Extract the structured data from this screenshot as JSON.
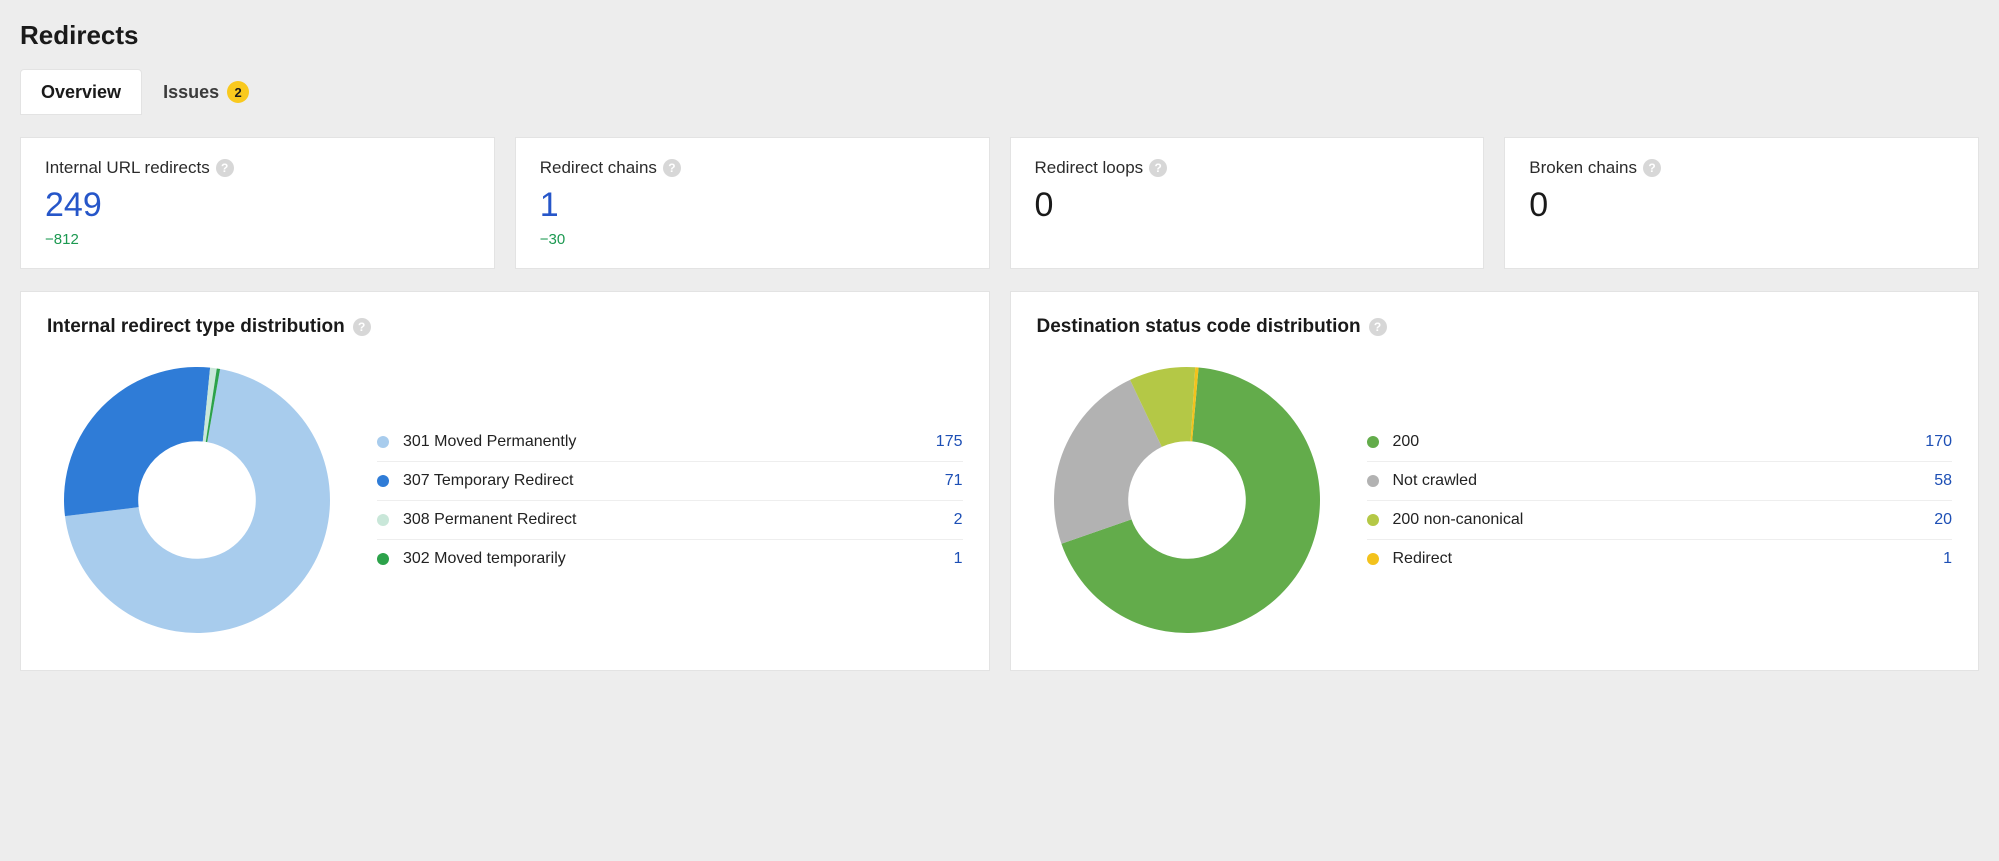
{
  "page_title": "Redirects",
  "tabs": {
    "overview": "Overview",
    "issues": "Issues",
    "issues_count": "2"
  },
  "stats": {
    "internal_redirects": {
      "label": "Internal URL redirects",
      "value": "249",
      "delta": "−812"
    },
    "redirect_chains": {
      "label": "Redirect chains",
      "value": "1",
      "delta": "−30"
    },
    "redirect_loops": {
      "label": "Redirect loops",
      "value": "0"
    },
    "broken_chains": {
      "label": "Broken chains",
      "value": "0"
    }
  },
  "charts": {
    "redirect_type": {
      "title": "Internal redirect type distribution",
      "items": [
        {
          "label": "301 Moved Permanently",
          "value": 175,
          "color": "#a8cced"
        },
        {
          "label": "307 Temporary Redirect",
          "value": 71,
          "color": "#2f7cd7"
        },
        {
          "label": "308 Permanent Redirect",
          "value": 2,
          "color": "#c9e7d9"
        },
        {
          "label": "302 Moved temporarily",
          "value": 1,
          "color": "#2ca24a"
        }
      ]
    },
    "dest_status": {
      "title": "Destination status code distribution",
      "items": [
        {
          "label": "200",
          "value": 170,
          "color": "#63ac4b"
        },
        {
          "label": "Not crawled",
          "value": 58,
          "color": "#b2b2b2"
        },
        {
          "label": "200 non-canonical",
          "value": 20,
          "color": "#b4c846"
        },
        {
          "label": "Redirect",
          "value": 1,
          "color": "#f3c21c"
        }
      ]
    }
  },
  "chart_data": [
    {
      "type": "pie",
      "title": "Internal redirect type distribution",
      "series": [
        {
          "name": "301 Moved Permanently",
          "value": 175
        },
        {
          "name": "307 Temporary Redirect",
          "value": 71
        },
        {
          "name": "308 Permanent Redirect",
          "value": 2
        },
        {
          "name": "302 Moved temporarily",
          "value": 1
        }
      ]
    },
    {
      "type": "pie",
      "title": "Destination status code distribution",
      "series": [
        {
          "name": "200",
          "value": 170
        },
        {
          "name": "Not crawled",
          "value": 58
        },
        {
          "name": "200 non-canonical",
          "value": 20
        },
        {
          "name": "Redirect",
          "value": 1
        }
      ]
    }
  ]
}
